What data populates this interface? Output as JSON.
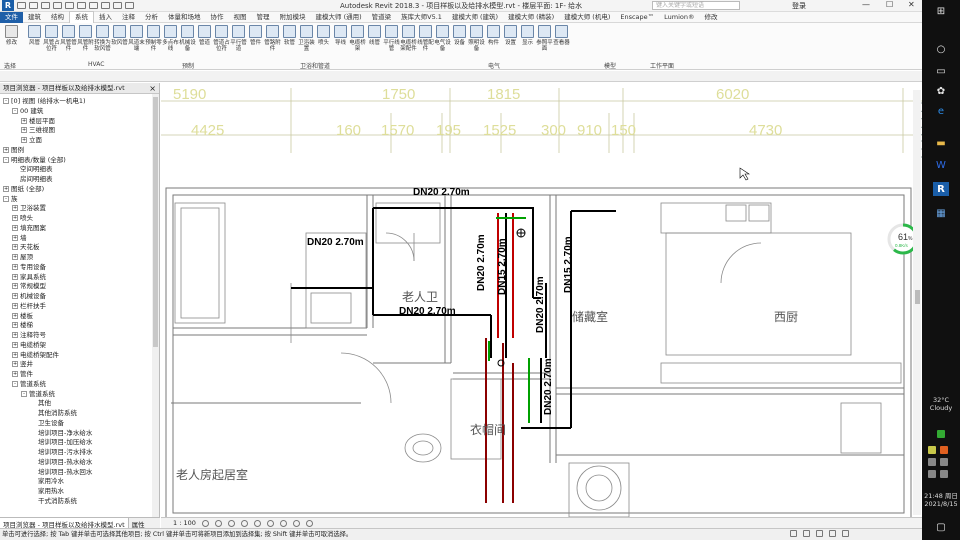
{
  "app": {
    "logo_letter": "R",
    "title": "Autodesk Revit 2018.3 -    项目样板以及给排水模型.rvt - 楼层平面: 1F- 给水",
    "search_placeholder": "键入关键字或短语",
    "login": "登录",
    "minimize": "—",
    "restore": "☐",
    "close": "✕"
  },
  "menu_tabs": [
    "文件",
    "建筑",
    "结构",
    "系统",
    "插入",
    "注释",
    "分析",
    "体量和场地",
    "协作",
    "视图",
    "管理",
    "附加模块",
    "建模大师 (通用)",
    "管道梁",
    "族库大师V5.1",
    "建模大师 (建筑)",
    "建模大师 (精装)",
    "建模大师 (机电)",
    "Enscape™",
    "Lumion®",
    "修改"
  ],
  "ribbon": {
    "buttons": [
      "修改",
      "风管",
      "风管占位符",
      "风管管件",
      "风管附件",
      "转换为软风管",
      "软风管",
      "风道末端",
      "预制零件",
      "多点布线",
      "机械设备",
      "管道",
      "管道占位符",
      "平行管道",
      "管件",
      "管路附件",
      "软管",
      "卫浴装置",
      "喷头",
      "导线",
      "电缆桥架",
      "线管",
      "平行线管",
      "电缆桥架配件",
      "线管配件",
      "电气设备",
      "设备",
      "照明设备",
      "构件",
      "设置",
      "显示",
      "参照平面",
      "查看器"
    ],
    "groups": [
      "选择",
      "HVAC",
      "预制",
      "卫浴和管道",
      "电气",
      "模型",
      "工作平面"
    ]
  },
  "project_browser": {
    "title": "项目浏览器 - 项目样板以及给排水模型.rvt",
    "close": "×",
    "items": [
      {
        "indent": 0,
        "toggle": "-",
        "label": "[0] 视图 (给排水一机电1)"
      },
      {
        "indent": 1,
        "toggle": "-",
        "label": "00 建筑"
      },
      {
        "indent": 2,
        "toggle": "+",
        "label": "楼层平面"
      },
      {
        "indent": 2,
        "toggle": "+",
        "label": "三维视图"
      },
      {
        "indent": 2,
        "toggle": "+",
        "label": "立面"
      },
      {
        "indent": 0,
        "toggle": "+",
        "label": "图例"
      },
      {
        "indent": 0,
        "toggle": "-",
        "label": "明细表/数量 (全部)"
      },
      {
        "indent": 1,
        "toggle": "",
        "label": "空间明细表"
      },
      {
        "indent": 1,
        "toggle": "",
        "label": "房间明细表"
      },
      {
        "indent": 0,
        "toggle": "+",
        "label": "图纸 (全部)"
      },
      {
        "indent": 0,
        "toggle": "-",
        "label": "族"
      },
      {
        "indent": 1,
        "toggle": "+",
        "label": "卫浴装置"
      },
      {
        "indent": 1,
        "toggle": "+",
        "label": "喷头"
      },
      {
        "indent": 1,
        "toggle": "+",
        "label": "填充图案"
      },
      {
        "indent": 1,
        "toggle": "+",
        "label": "墙"
      },
      {
        "indent": 1,
        "toggle": "+",
        "label": "天花板"
      },
      {
        "indent": 1,
        "toggle": "+",
        "label": "屋顶"
      },
      {
        "indent": 1,
        "toggle": "+",
        "label": "专用设备"
      },
      {
        "indent": 1,
        "toggle": "+",
        "label": "家具系统"
      },
      {
        "indent": 1,
        "toggle": "+",
        "label": "常规模型"
      },
      {
        "indent": 1,
        "toggle": "+",
        "label": "机械设备"
      },
      {
        "indent": 1,
        "toggle": "+",
        "label": "栏杆扶手"
      },
      {
        "indent": 1,
        "toggle": "+",
        "label": "楼板"
      },
      {
        "indent": 1,
        "toggle": "+",
        "label": "楼梯"
      },
      {
        "indent": 1,
        "toggle": "+",
        "label": "注释符号"
      },
      {
        "indent": 1,
        "toggle": "+",
        "label": "电缆桥架"
      },
      {
        "indent": 1,
        "toggle": "+",
        "label": "电缆桥架配件"
      },
      {
        "indent": 1,
        "toggle": "+",
        "label": "竖井"
      },
      {
        "indent": 1,
        "toggle": "+",
        "label": "管件"
      },
      {
        "indent": 1,
        "toggle": "-",
        "label": "管道系统"
      },
      {
        "indent": 2,
        "toggle": "-",
        "label": "管道系统"
      },
      {
        "indent": 3,
        "toggle": "",
        "label": "其他"
      },
      {
        "indent": 3,
        "toggle": "",
        "label": "其他消防系统"
      },
      {
        "indent": 3,
        "toggle": "",
        "label": "卫生设备"
      },
      {
        "indent": 3,
        "toggle": "",
        "label": "培训项目-净水给水"
      },
      {
        "indent": 3,
        "toggle": "",
        "label": "培训项目-加压给水"
      },
      {
        "indent": 3,
        "toggle": "",
        "label": "培训项目-污水排水"
      },
      {
        "indent": 3,
        "toggle": "",
        "label": "培训项目-热水给水"
      },
      {
        "indent": 3,
        "toggle": "",
        "label": "培训项目-热水回水"
      },
      {
        "indent": 3,
        "toggle": "",
        "label": "家用冷水"
      },
      {
        "indent": 3,
        "toggle": "",
        "label": "家用热水"
      },
      {
        "indent": 3,
        "toggle": "",
        "label": "干式消防系统"
      }
    ],
    "tabs": [
      "项目浏览器 - 项目样板以及给排水模型.rvt",
      "属性"
    ]
  },
  "drawing": {
    "dims_top": [
      "5190",
      "1750",
      "1815",
      "6020"
    ],
    "dims_second": [
      "4425",
      "160",
      "1570",
      "195",
      "1525",
      "300",
      "910",
      "150",
      "4730"
    ],
    "pipe_labels": [
      "DN20 2.70m",
      "DN20 2.70m",
      "DN20 2.70m",
      "DN20 2.70m",
      "DN15 2.70m",
      "DN15 2.70m",
      "DN20 2.70m",
      "DN20 2.70m"
    ],
    "rooms": [
      "老人卫",
      "储藏室",
      "西厨",
      "衣帽间",
      "老人房起居室"
    ],
    "progress_value": "61",
    "progress_unit": "%",
    "progress_sub": "0.8K/s"
  },
  "view_control": {
    "scale": "1 : 100"
  },
  "status_bar": {
    "text": "单击可进行选择; 按 Tab 键并单击可选择其他项目; 按 Ctrl 键并单击可将新项目添加到选择集; 按 Shift 键并单击可取消选择。"
  },
  "taskbar": {
    "temperature": "32°C",
    "weather": "Cloudy",
    "time": "21:48 周日",
    "date": "2021/8/15"
  }
}
